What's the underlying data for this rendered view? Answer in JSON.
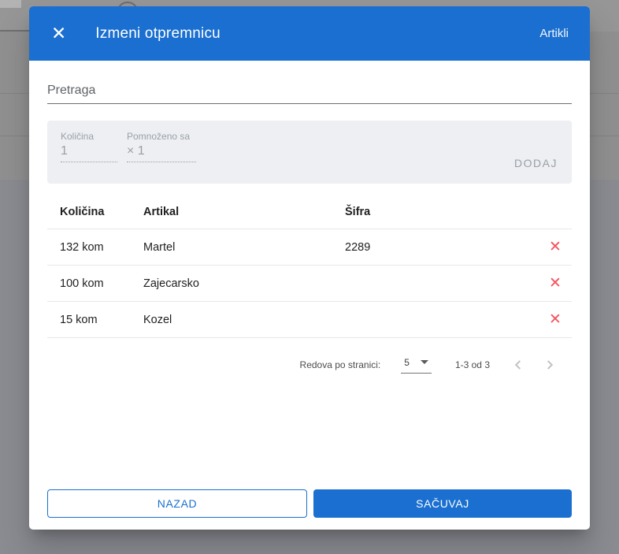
{
  "modal": {
    "title": "Izmeni otpremnicu",
    "close_icon": "✕",
    "header_action": "Artikli",
    "search": {
      "placeholder": "Pretraga",
      "value": ""
    },
    "add_panel": {
      "quantity_label": "Količina",
      "quantity_value": "1",
      "multiplier_label": "Pomnoženo sa",
      "multiplier_value": "× 1",
      "add_button": "DODAJ"
    },
    "table": {
      "headers": [
        "Količina",
        "Artikal",
        "Šifra"
      ],
      "delete_icon": "✕",
      "rows": [
        {
          "quantity": "132 kom",
          "article": "Martel",
          "code": "2289"
        },
        {
          "quantity": "100 kom",
          "article": "Zajecarsko",
          "code": ""
        },
        {
          "quantity": "15 kom",
          "article": "Kozel",
          "code": ""
        }
      ]
    },
    "paginator": {
      "rows_per_page_label": "Redova po stranici:",
      "rows_per_page_value": "5",
      "range_label": "1-3 od 3"
    },
    "footer": {
      "back_button": "NAZAD",
      "save_button": "SAČUVAJ"
    }
  },
  "colors": {
    "primary_blue": "#1a6fd0",
    "delete_red": "#f4515c",
    "panel_gray": "#edeff2",
    "overlay_gray": "#8f8f8f"
  }
}
